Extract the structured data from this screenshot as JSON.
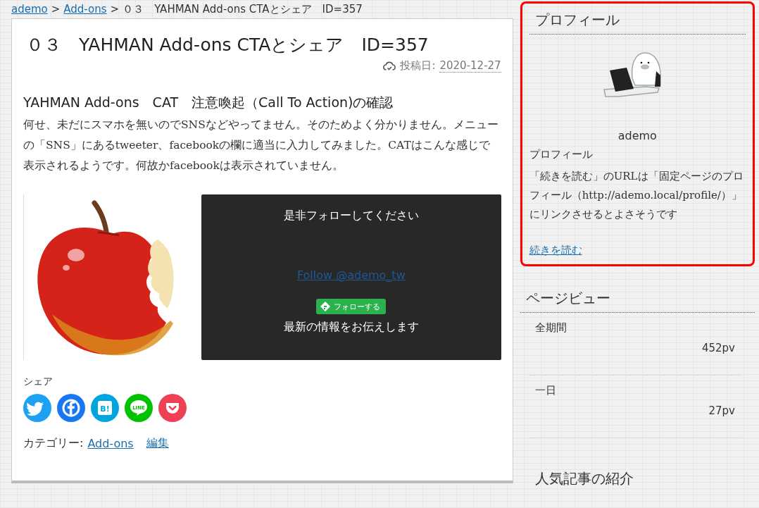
{
  "breadcrumb": {
    "links": [
      "ademo",
      "Add-ons"
    ],
    "separator": ">",
    "current": "０３　YAHMAN Add-ons CTAとシェア　ID=357"
  },
  "article": {
    "title": "０３　YAHMAN Add-ons CTAとシェア　ID=357",
    "date_label": "投稿日:",
    "date": "2020-12-27",
    "heading": "YAHMAN Add-ons　CAT　注意喚起（Call To Action)の確認",
    "body": "何せ、未だにスマホを無いのでSNSなどやってません。そのためよく分かりません。メニューの「SNS」にあるtweeter、facebookの欄に適当に入力してみました。CATはこんな感じで表示されるようです。何故かfacebookは表示されていません。",
    "cta": {
      "title": "是非フォローしてください",
      "follow_link": "Follow @ademo_tw",
      "feedly_button": "フォローする",
      "subtitle": "最新の情報をお伝えします"
    },
    "share_label": "シェア",
    "share_buttons": [
      {
        "kind": "twitter",
        "color": "#1da1f2"
      },
      {
        "kind": "facebook",
        "color": "#1877f2"
      },
      {
        "kind": "hatena",
        "color": "#00a4de",
        "label": "B!"
      },
      {
        "kind": "line",
        "color": "#00c300",
        "label": "LINE"
      },
      {
        "kind": "pocket",
        "color": "#ef4056"
      }
    ],
    "category_label": "カテゴリー:",
    "category": "Add-ons",
    "edit_link": "編集"
  },
  "sidebar": {
    "profile": {
      "title": "プロフィール",
      "name": "ademo",
      "text_title": "プロフィール",
      "text": "「続きを読む」のURLは「固定ページのプロフィール（http://ademo.local/profile/）」にリンクさせるとよさそうです",
      "read_more": "続きを読む",
      "highlighted": true
    },
    "pageviews": {
      "title": "ページビュー",
      "items": [
        {
          "label": "全期間",
          "value": "452pv"
        },
        {
          "label": "一日",
          "value": "27pv"
        }
      ]
    },
    "popular": {
      "title": "人気記事の紹介"
    }
  }
}
